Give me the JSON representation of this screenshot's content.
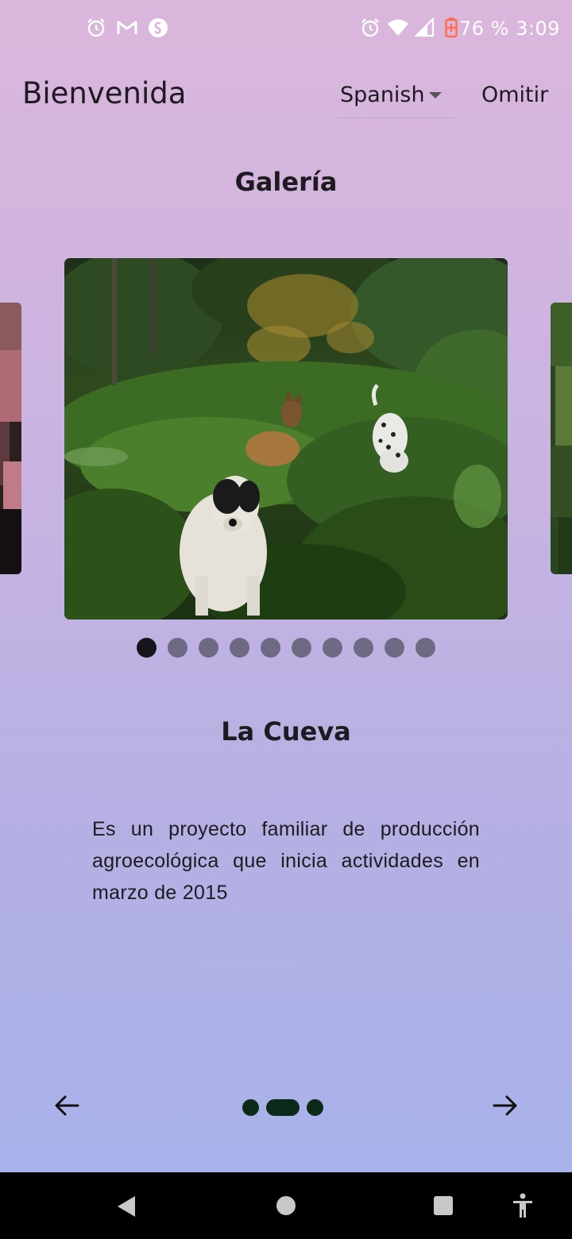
{
  "status_bar": {
    "battery_time": "76 % 3:09",
    "left_icons": [
      "alarm-icon",
      "gmail-icon",
      "shazam-icon"
    ],
    "right_icons": [
      "alarm-icon",
      "wifi-icon",
      "signal-icon",
      "battery-icon"
    ]
  },
  "header": {
    "title": "Bienvenida",
    "language": "Spanish",
    "skip_label": "Omitir"
  },
  "gallery": {
    "title": "Galería",
    "slide_count": 10,
    "active_index": 0
  },
  "place": {
    "title": "La Cueva",
    "description": "Es un proyecto familiar de producción agroecológica que inicia actividades en marzo de 2015"
  },
  "onboarding": {
    "page_count": 3,
    "current_page": 1
  },
  "colors": {
    "gradient_top": "#dbb6dc",
    "gradient_bottom": "#a6b3ec",
    "text": "#1d1b20",
    "indicator": "#0c2a1a",
    "dot_inactive": "#6f6a84",
    "dot_active": "#16141c"
  }
}
